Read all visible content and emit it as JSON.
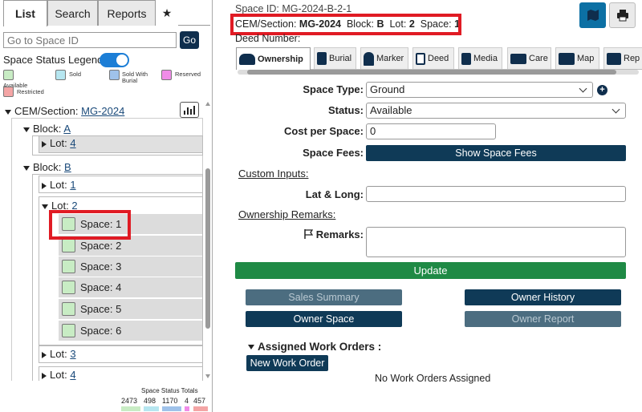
{
  "left_tabs": [
    "List",
    "Search",
    "Reports",
    "★"
  ],
  "goto": {
    "placeholder": "Go to Space ID",
    "button": "Go"
  },
  "legend": {
    "title": "Space Status Legend:",
    "items": [
      {
        "label": "Available",
        "color": "#c8ecc4"
      },
      {
        "label": "Sold",
        "color": "#b6e6f0"
      },
      {
        "label": "Sold With Burial",
        "color": "#9fc2ea"
      },
      {
        "label": "Reserved",
        "color": "#f08ce8"
      },
      {
        "label": "Restricted",
        "color": "#f4a5a5"
      }
    ]
  },
  "tree": {
    "cem_label": "CEM/Section:",
    "cem_value": "MG-2024",
    "block_label": "Block:",
    "lot_label": "Lot:",
    "space_label": "Space:",
    "blocks": [
      "A",
      "B"
    ],
    "lots_a": [
      "4"
    ],
    "lots_b": [
      "1",
      "2",
      "3",
      "4"
    ],
    "spaces": [
      "1",
      "2",
      "3",
      "4",
      "5",
      "6"
    ]
  },
  "totals": {
    "title": "Space Status Totals",
    "values": [
      "2473",
      "498",
      "1170",
      "4",
      "457"
    ]
  },
  "header": {
    "space_id_label": "Space ID:",
    "space_id": "MG-2024-B-2-1",
    "cem_label": "CEM/Section:",
    "cem": "MG-2024",
    "block_label": "Block:",
    "block": "B",
    "lot_label": "Lot:",
    "lot": "2",
    "space_label": "Space:",
    "space": "1",
    "deed_label": "Deed Number:"
  },
  "tabs": [
    "Ownership",
    "Burial",
    "Marker",
    "Deed",
    "Media",
    "Care",
    "Map",
    "Rep"
  ],
  "form": {
    "space_type_label": "Space Type:",
    "space_type": "Ground",
    "status_label": "Status:",
    "status": "Available",
    "cost_label": "Cost per Space:",
    "cost": "0",
    "fees_label": "Space Fees:",
    "fees_button": "Show Space Fees",
    "custom_inputs": "Custom Inputs:",
    "latlong_label": "Lat & Long:",
    "latlong": "",
    "remarks_section": "Ownership Remarks:",
    "remarks_label": "Remarks:",
    "remarks": ""
  },
  "actions": {
    "update": "Update",
    "sales_summary": "Sales Summary",
    "owner_history": "Owner History",
    "owner_space": "Owner Space",
    "owner_report": "Owner Report"
  },
  "work_orders": {
    "title": "Assigned Work Orders :",
    "new_button": "New Work Order",
    "empty": "No Work Orders Assigned"
  },
  "colors": {
    "dark": "#0f3a57",
    "green": "#1f8a45",
    "highlight": "#e01b24"
  }
}
